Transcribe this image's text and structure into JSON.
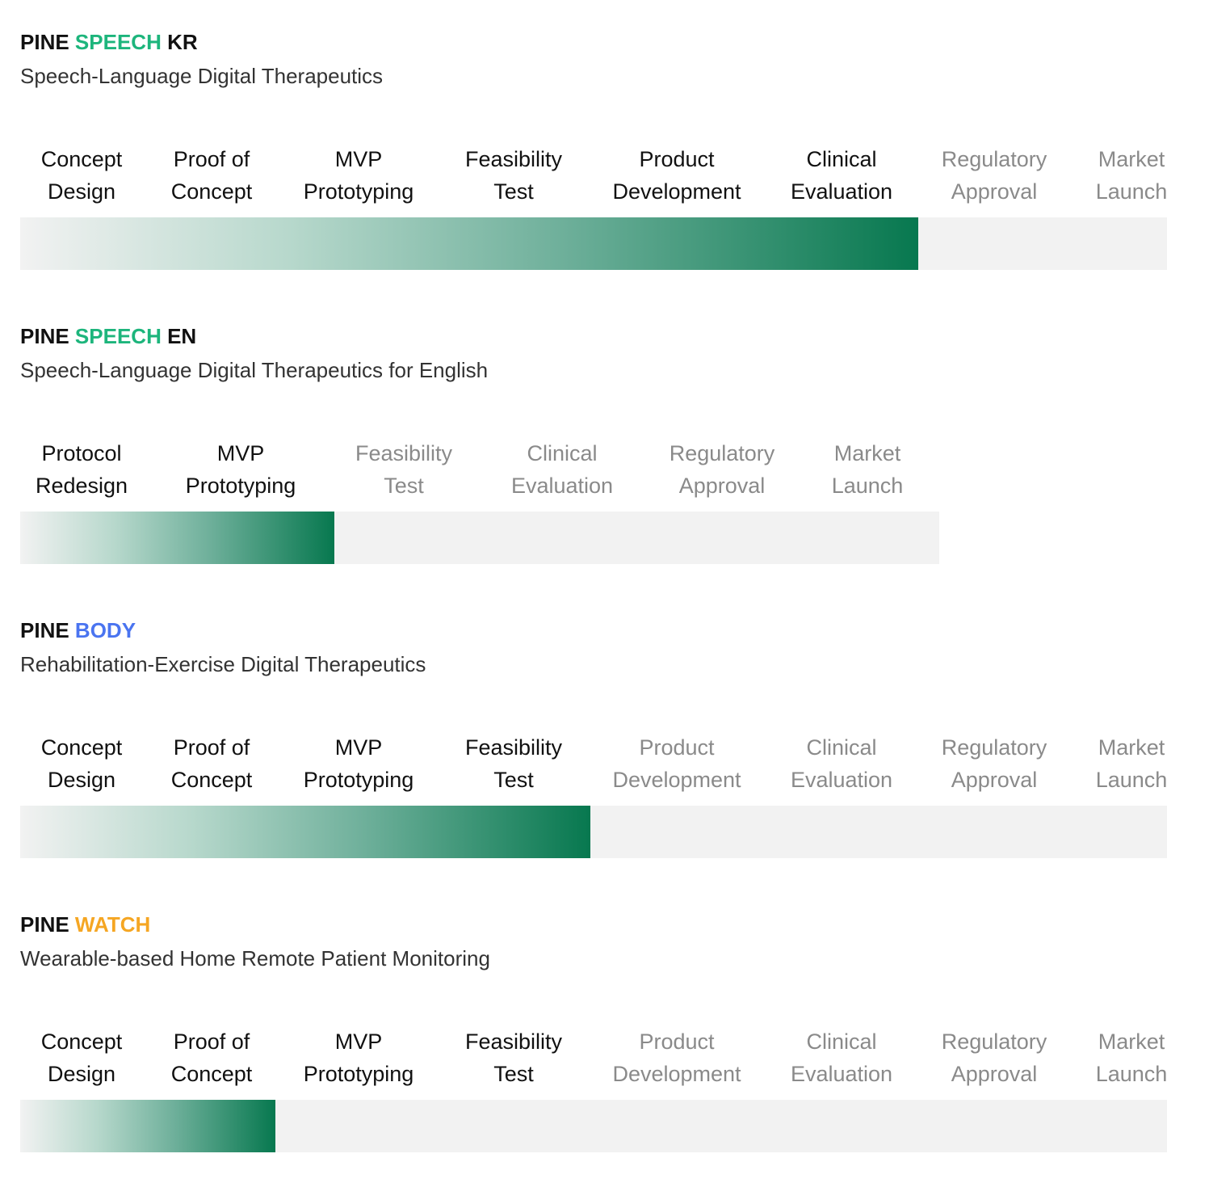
{
  "colors": {
    "speech_accent": "#1db57c",
    "body_accent": "#4a74f0",
    "watch_accent": "#f5a623",
    "done_text": "#111111",
    "todo_text": "#8a8a8a",
    "fill_end": "#07784f",
    "track": "#f2f2f2"
  },
  "products": [
    {
      "title_prefix": "PINE ",
      "title_accent": "SPEECH",
      "title_suffix": " KR",
      "accent_color": "#1db57c",
      "subtitle": "Speech-Language Digital Therapeutics",
      "completed_stages": 6,
      "stages": [
        {
          "line1": "Concept",
          "line2": "Design"
        },
        {
          "line1": "Proof of",
          "line2": "Concept"
        },
        {
          "line1": "MVP",
          "line2": "Prototyping"
        },
        {
          "line1": "Feasibility",
          "line2": "Test"
        },
        {
          "line1": "Product",
          "line2": "Development"
        },
        {
          "line1": "Clinical",
          "line2": "Evaluation"
        },
        {
          "line1": "Regulatory",
          "line2": "Approval"
        },
        {
          "line1": "Market",
          "line2": "Launch"
        }
      ]
    },
    {
      "title_prefix": "PINE ",
      "title_accent": "SPEECH",
      "title_suffix": " EN",
      "accent_color": "#1db57c",
      "subtitle": "Speech-Language Digital Therapeutics for English",
      "completed_stages": 2,
      "stages": [
        {
          "line1": "Protocol",
          "line2": "Redesign"
        },
        {
          "line1": "MVP",
          "line2": "Prototyping"
        },
        {
          "line1": "Feasibility",
          "line2": "Test"
        },
        {
          "line1": "Clinical",
          "line2": "Evaluation"
        },
        {
          "line1": "Regulatory",
          "line2": "Approval"
        },
        {
          "line1": "Market",
          "line2": "Launch"
        }
      ]
    },
    {
      "title_prefix": "PINE ",
      "title_accent": "BODY",
      "title_suffix": "",
      "accent_color": "#4a74f0",
      "subtitle": "Rehabilitation-Exercise Digital Therapeutics",
      "completed_stages": 4,
      "stages": [
        {
          "line1": "Concept",
          "line2": "Design"
        },
        {
          "line1": "Proof of",
          "line2": "Concept"
        },
        {
          "line1": "MVP",
          "line2": "Prototyping"
        },
        {
          "line1": "Feasibility",
          "line2": "Test"
        },
        {
          "line1": "Product",
          "line2": "Development"
        },
        {
          "line1": "Clinical",
          "line2": "Evaluation"
        },
        {
          "line1": "Regulatory",
          "line2": "Approval"
        },
        {
          "line1": "Market",
          "line2": "Launch"
        }
      ]
    },
    {
      "title_prefix": "PINE ",
      "title_accent": "WATCH",
      "title_suffix": "",
      "accent_color": "#f5a623",
      "subtitle": "Wearable-based Home Remote Patient Monitoring",
      "completed_stages": 2,
      "stages": [
        {
          "line1": "Concept",
          "line2": "Design"
        },
        {
          "line1": "Proof of",
          "line2": "Concept"
        },
        {
          "line1": "MVP",
          "line2": "Prototyping"
        },
        {
          "line1": "Feasibility",
          "line2": "Test"
        },
        {
          "line1": "Product",
          "line2": "Development"
        },
        {
          "line1": "Clinical",
          "line2": "Evaluation"
        },
        {
          "line1": "Regulatory",
          "line2": "Approval"
        },
        {
          "line1": "Market",
          "line2": "Launch"
        }
      ]
    }
  ]
}
